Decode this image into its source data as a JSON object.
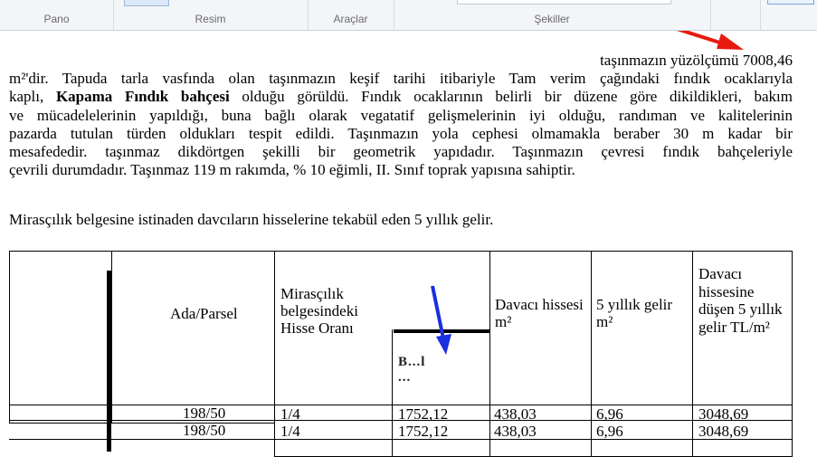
{
  "ribbon": {
    "groups": [
      "Pano",
      "Resim",
      "Araçlar",
      "Şekiller"
    ]
  },
  "document": {
    "area_line": "taşınmazın yüzölçümü 7008,46",
    "paragraph_lines": [
      "m²'dir. Tapuda tarla vasfında olan taşınmazın keşif tarihi itibariyle Tam verim çağındaki fındık ocaklarıyla",
      "kaplı, |Kapama Fındık bahçesi| olduğu görüldü. Fındık ocaklarının belirli bir düzene göre dikildikleri, bakım",
      "ve mücadelelerinin yapıldığı, buna bağlı olarak vegatatif gelişmelerinin iyi olduğu, randıman ve kalitelerinin",
      "pazarda tutulan türden oldukları tespit edildi. Taşınmazın yola cephesi olmamakla beraber 30 m kadar bir",
      "mesafededir. taşınmaz dikdörtgen şekilli bir geometrik yapıdadır. Taşınmazın çevresi fındık bahçeleriyle",
      "çevrili durumdadır. Taşınmaz 119 m rakımda, % 10 eğimli, II. Sınıf toprak yapısına sahiptir."
    ],
    "bold_phrase": "Kapama Fındık bahçesi",
    "table_intro": "Mirasçılık belgesine istinaden davcıların hisselerine tekabül eden 5 yıllık gelir."
  },
  "table": {
    "headers": {
      "parcel": "Ada/Parsel",
      "share_ratio": "Mirasçılık belgesindeki Hisse Oranı",
      "obscured": "B...l ...",
      "claimant_share": "Davacı hissesi m²",
      "five_year_income": "5 yıllık gelir m²",
      "claimant_income": "Davacı hissesine düşen 5 yıllık gelir TL/m²"
    },
    "rows": [
      [
        "198/50",
        "1/4",
        "1752,12",
        "438,03",
        "6,96",
        "3048,69"
      ],
      [
        "198/50",
        "1/4",
        "1752,12",
        "438,03",
        "6,96",
        "3048,69"
      ]
    ]
  },
  "annotations": {
    "arrow_colors": [
      "#e8190f",
      "#1a2fe0"
    ]
  }
}
